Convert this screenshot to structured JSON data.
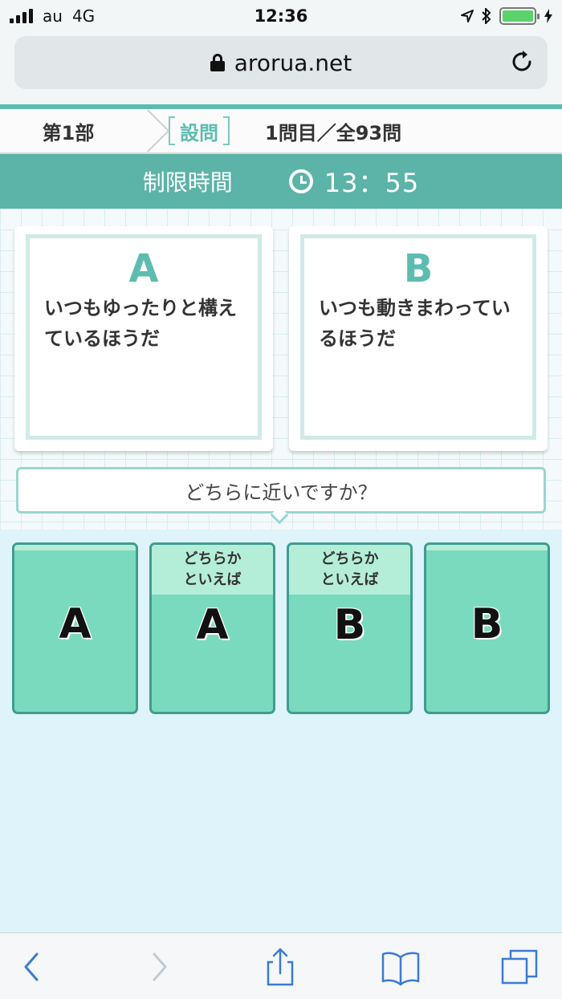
{
  "status": {
    "carrier": "au",
    "network": "4G",
    "time": "12:36"
  },
  "browser": {
    "url": "arorua.net"
  },
  "breadcrumb": {
    "part": "第1部",
    "tag": "設問",
    "count": "1問目／全93問"
  },
  "timer": {
    "label": "制限時間",
    "value": "13：55"
  },
  "options": {
    "a": {
      "letter": "A",
      "text": "いつもゆったりと構えているほうだ"
    },
    "b": {
      "letter": "B",
      "text": "いつも動きまわっているほうだ"
    }
  },
  "prompt": "どちらに近いですか？",
  "answers": [
    {
      "letter": "A",
      "sub": ""
    },
    {
      "letter": "A",
      "sub": "どちらか\nといえば"
    },
    {
      "letter": "B",
      "sub": "どちらか\nといえば"
    },
    {
      "letter": "B",
      "sub": ""
    }
  ],
  "colors": {
    "accent": "#5dbcb0",
    "timer_bg": "#5cb3a8",
    "answer_bg": "#7adabd",
    "answer_border": "#3f9c90"
  },
  "icons": [
    "lock-icon",
    "reload-icon",
    "clock-icon",
    "back-icon",
    "forward-icon",
    "share-icon",
    "bookmarks-icon",
    "tabs-icon"
  ]
}
